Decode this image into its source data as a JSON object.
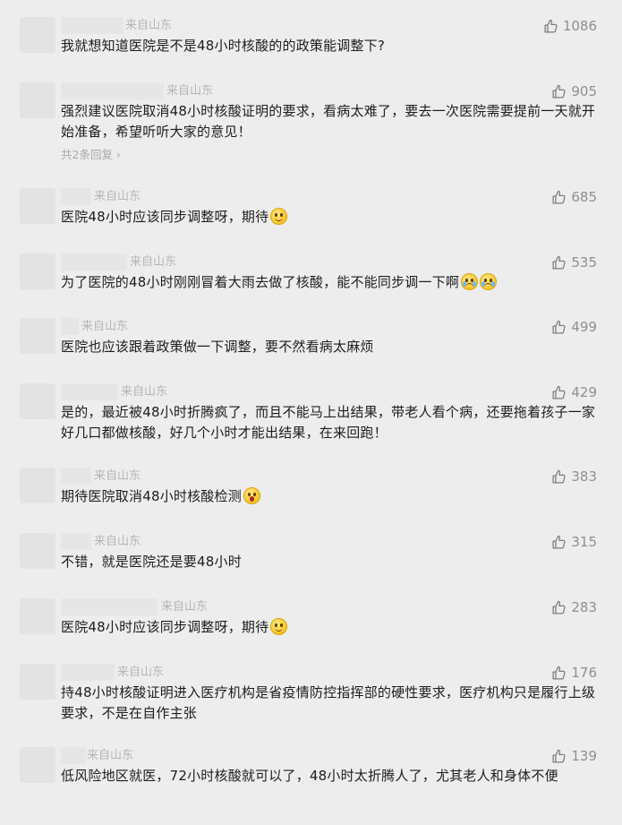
{
  "colors": {
    "background": "#ededed",
    "text": "#1d1d1d",
    "meta": "#b5b5b5",
    "like": "#8f8f8f"
  },
  "comments": [
    {
      "location": "来自山东",
      "likes": "1086",
      "text": "我就想知道医院是不是48小时核酸的的政策能调整下?",
      "emoji": []
    },
    {
      "location": "来自山东",
      "likes": "905",
      "text": "强烈建议医院取消48小时核酸证明的要求，看病太难了，要去一次医院需要提前一天就开始准备，希望听听大家的意见！",
      "replies": "共2条回复",
      "emoji": []
    },
    {
      "location": "来自山东",
      "likes": "685",
      "text": "医院48小时应该同步调整呀，期待",
      "emoji": [
        "smile-emoji"
      ]
    },
    {
      "location": "来自山东",
      "likes": "535",
      "text": "为了医院的48小时刚刚冒着大雨去做了核酸，能不能同步调一下啊",
      "emoji": [
        "cry-emoji",
        "cry-emoji"
      ]
    },
    {
      "location": "来自山东",
      "likes": "499",
      "text": "医院也应该跟着政策做一下调整，要不然看病太麻烦",
      "emoji": []
    },
    {
      "location": "来自山东",
      "likes": "429",
      "text": "是的，最近被48小时折腾疯了，而且不能马上出结果，带老人看个病，还要拖着孩子一家好几口都做核酸，好几个小时才能出结果，在来回跑！",
      "emoji": []
    },
    {
      "location": "来自山东",
      "likes": "383",
      "text": "期待医院取消48小时核酸检测",
      "emoji": [
        "shocked-emoji"
      ]
    },
    {
      "location": "来自山东",
      "likes": "315",
      "text": "不错，就是医院还是要48小时",
      "emoji": []
    },
    {
      "location": "来自山东",
      "likes": "283",
      "text": "医院48小时应该同步调整呀，期待",
      "emoji": [
        "smile-emoji"
      ]
    },
    {
      "location": "来自山东",
      "likes": "176",
      "text": "持48小时核酸证明进入医疗机构是省疫情防控指挥部的硬性要求，医疗机构只是履行上级要求，不是在自作主张",
      "emoji": []
    },
    {
      "location": "来自山东",
      "likes": "139",
      "text": "低风险地区就医，72小时核酸就可以了，48小时太折腾人了，尤其老人和身体不便",
      "emoji": []
    }
  ]
}
